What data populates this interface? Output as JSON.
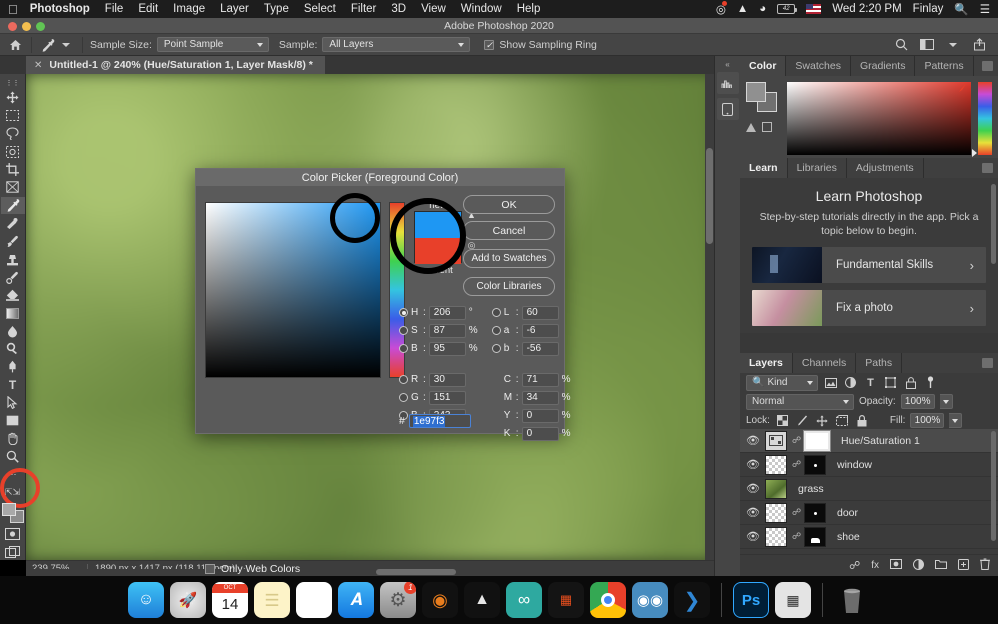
{
  "menubar": {
    "apple_icon": "apple-icon",
    "items": [
      "Photoshop",
      "File",
      "Edit",
      "Image",
      "Layer",
      "Type",
      "Select",
      "Filter",
      "3D",
      "View",
      "Window",
      "Help"
    ],
    "status_icons": [
      "screen-sharing-icon",
      "dropbox-icon",
      "wifi-icon",
      "battery-icon",
      "us-flag-icon"
    ],
    "battery_level": "42",
    "clock": "Wed 2:20 PM",
    "user": "Finlay",
    "search_icon": "search-icon",
    "control_center_icon": "control-center-icon"
  },
  "titlebar": {
    "title": "Adobe Photoshop 2020"
  },
  "options_bar": {
    "home_icon": "home-icon",
    "tool_icon": "eyedropper-icon",
    "tool_preset_caret": "chevron-down-icon",
    "sample_size_label": "Sample Size:",
    "sample_size_value": "Point Sample",
    "sample_label": "Sample:",
    "sample_value": "All Layers",
    "show_sampling_ring_label": "Show Sampling Ring",
    "show_sampling_ring_checked": true,
    "right_icons": [
      "search-icon",
      "workspace-icon",
      "chevron-down-icon",
      "share-icon"
    ]
  },
  "document_tab": {
    "close_icon": "close-icon",
    "title": "Untitled-1 @ 240% (Hue/Saturation 1, Layer Mask/8) *"
  },
  "toolbar": {
    "tools": [
      "move-tool",
      "marquee-tool",
      "lasso-tool",
      "object-selection-tool",
      "crop-tool",
      "frame-tool",
      "eyedropper-tool",
      "spot-healing-tool",
      "brush-tool",
      "clone-stamp-tool",
      "history-brush-tool",
      "eraser-tool",
      "gradient-tool",
      "blur-tool",
      "dodge-tool",
      "pen-tool",
      "type-tool",
      "path-selection-tool",
      "rectangle-tool",
      "hand-tool",
      "zoom-tool"
    ],
    "more_tools_icon": "more-tools-icon",
    "foreground_background_icon": "foreground-background-swatch",
    "quick-mask_icon": "quick-mask-icon",
    "screen_mode_icon": "screen-mode-icon",
    "selected_tool": "eyedropper-tool"
  },
  "status_bar": {
    "zoom": "239.75%",
    "doc_info": "1890 px x 1417 px (118.11 ppcm)",
    "arrow_icon": "chevron-right-icon"
  },
  "color_picker": {
    "title": "Color Picker (Foreground Color)",
    "buttons": {
      "ok": "OK",
      "cancel": "Cancel",
      "add_to_swatches": "Add to Swatches",
      "color_libraries": "Color Libraries"
    },
    "swatch": {
      "new_label": "new",
      "current_label": "current",
      "new_color": "#1e97f3",
      "current_color": "#e8402a"
    },
    "hsb": [
      {
        "name": "H",
        "value": "206",
        "unit": "°",
        "selected": true
      },
      {
        "name": "S",
        "value": "87",
        "unit": "%",
        "selected": false
      },
      {
        "name": "B",
        "value": "95",
        "unit": "%",
        "selected": false
      }
    ],
    "rgb": [
      {
        "name": "R",
        "value": "30",
        "unit": "",
        "selected": false
      },
      {
        "name": "G",
        "value": "151",
        "unit": "",
        "selected": false
      },
      {
        "name": "B",
        "value": "243",
        "unit": "",
        "selected": false
      }
    ],
    "lab": [
      {
        "name": "L",
        "value": "60",
        "unit": "",
        "selected": false
      },
      {
        "name": "a",
        "value": "-6",
        "unit": "",
        "selected": false
      },
      {
        "name": "b",
        "value": "-56",
        "unit": "",
        "selected": false
      }
    ],
    "cmyk": [
      {
        "name": "C",
        "value": "71",
        "unit": "%"
      },
      {
        "name": "M",
        "value": "34",
        "unit": "%"
      },
      {
        "name": "Y",
        "value": "0",
        "unit": "%"
      },
      {
        "name": "K",
        "value": "0",
        "unit": "%"
      }
    ],
    "hex_prefix": "#",
    "hex_value": "1e97f3",
    "only_web_colors_label": "Only Web Colors",
    "only_web_colors_checked": false
  },
  "right_dock": {
    "collapse_icon": "collapse-panels-icon",
    "icons": [
      "histogram-icon",
      "device-preview-icon"
    ]
  },
  "color_panel": {
    "tabs": [
      "Color",
      "Swatches",
      "Gradients",
      "Patterns"
    ],
    "active_tab": "Color",
    "menu_icon": "panel-menu-icon",
    "foreground_swatch_icon": "foreground-swatch",
    "background_swatch_icon": "background-swatch",
    "gamut_warning_icon": "gamut-warning-icon",
    "web_safe_icon": "web-safe-icon"
  },
  "learn_panel": {
    "tabs": [
      "Learn",
      "Libraries",
      "Adjustments"
    ],
    "active_tab": "Learn",
    "menu_icon": "panel-menu-icon",
    "heading": "Learn Photoshop",
    "subheading": "Step-by-step tutorials directly in the app. Pick a topic below to begin.",
    "cards": [
      {
        "label": "Fundamental Skills",
        "chevron": "›"
      },
      {
        "label": "Fix a photo",
        "chevron": "›"
      }
    ]
  },
  "layers_panel": {
    "tabs": [
      "Layers",
      "Channels",
      "Paths"
    ],
    "active_tab": "Layers",
    "menu_icon": "panel-menu-icon",
    "filter_label": "Kind",
    "filter_icons": [
      "pixel-filter-icon",
      "adjustment-filter-icon",
      "type-filter-icon",
      "shape-filter-icon",
      "smart-object-filter-icon",
      "filter-toggle-icon"
    ],
    "blend_mode": "Normal",
    "opacity_label": "Opacity:",
    "opacity_value": "100%",
    "lock_label": "Lock:",
    "lock_icons": [
      "lock-transparency-icon",
      "lock-image-icon",
      "lock-position-icon",
      "lock-artboard-icon",
      "lock-all-icon"
    ],
    "fill_label": "Fill:",
    "fill_value": "100%",
    "layers": [
      {
        "name": "Hue/Saturation 1",
        "visible": true,
        "type": "adjustment",
        "selected": true,
        "linked": true
      },
      {
        "name": "window",
        "visible": true,
        "type": "pixel-mask",
        "selected": false,
        "linked": true
      },
      {
        "name": "grass",
        "visible": true,
        "type": "pixel",
        "selected": false,
        "linked": false
      },
      {
        "name": "door",
        "visible": true,
        "type": "pixel-mask",
        "selected": false,
        "linked": true
      },
      {
        "name": "shoe",
        "visible": true,
        "type": "pixel-mask",
        "selected": false,
        "linked": true
      }
    ],
    "footer_icons": [
      "link-layers-icon",
      "layer-style-icon",
      "add-mask-icon",
      "adjustment-layer-icon",
      "new-group-icon",
      "new-layer-icon",
      "delete-layer-icon"
    ]
  },
  "dock": {
    "apps": [
      {
        "name": "finder-icon",
        "glyph": "□",
        "color": "#1e8fe8",
        "running": true,
        "badge": ""
      },
      {
        "name": "launchpad-icon",
        "glyph": "●",
        "color": "#cfcfcf",
        "running": false,
        "badge": ""
      },
      {
        "name": "calendar-icon",
        "glyph": "14",
        "color": "#ffffff",
        "running": false,
        "badge": ""
      },
      {
        "name": "notes-icon",
        "glyph": "",
        "color": "#f7e7a8",
        "running": false,
        "badge": ""
      },
      {
        "name": "photos-icon",
        "glyph": "✿",
        "color": "#ffffff",
        "running": false,
        "badge": ""
      },
      {
        "name": "app-store-icon",
        "glyph": "A",
        "color": "#2e9ae8",
        "running": false,
        "badge": ""
      },
      {
        "name": "system-preferences-icon",
        "glyph": "⚙",
        "color": "#9a9a9a",
        "running": false,
        "badge": "1"
      },
      {
        "name": "blender-icon",
        "glyph": "◉",
        "color": "#e87d1e",
        "running": false,
        "badge": ""
      },
      {
        "name": "inkscape-icon",
        "glyph": "▲",
        "color": "#d8d8d8",
        "running": false,
        "badge": ""
      },
      {
        "name": "arduino-icon",
        "glyph": "∞",
        "color": "#3fb6ae",
        "running": false,
        "badge": ""
      },
      {
        "name": "fritzing-icon",
        "glyph": "∷",
        "color": "#e84f1e",
        "running": false,
        "badge": ""
      },
      {
        "name": "chrome-icon",
        "glyph": "●",
        "color": "#ffffff",
        "running": true,
        "badge": ""
      },
      {
        "name": "godot-icon",
        "glyph": "◑",
        "color": "#478cbf",
        "running": false,
        "badge": ""
      },
      {
        "name": "vscode-icon",
        "glyph": "≻",
        "color": "#2f7fc8",
        "running": false,
        "badge": ""
      },
      {
        "name": "photoshop-icon",
        "glyph": "Ps",
        "color": "#31a8ff",
        "running": true,
        "badge": ""
      },
      {
        "name": "calculator-icon",
        "glyph": "▦",
        "color": "#e8e8e8",
        "running": false,
        "badge": ""
      }
    ],
    "trash_icon": "trash-icon"
  }
}
